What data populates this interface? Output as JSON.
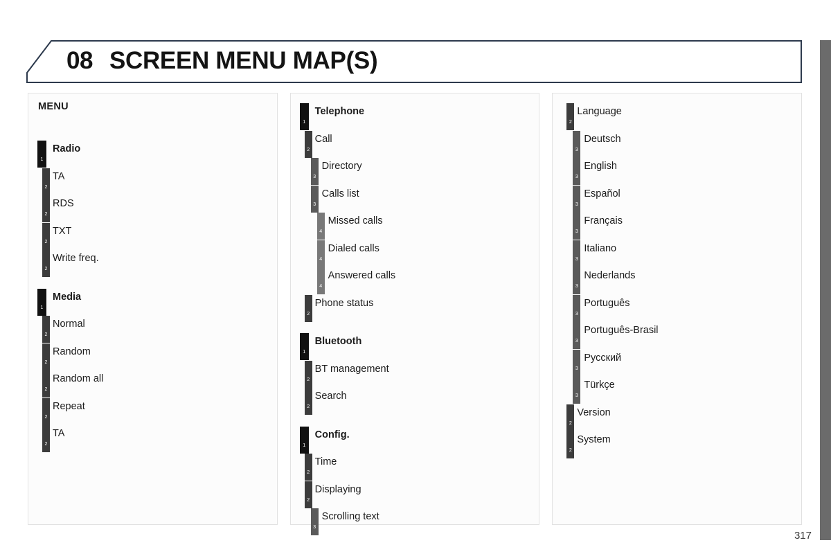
{
  "header": {
    "chapter_number": "08",
    "title": "SCREEN MENU MAP(S)",
    "border_color": "#2d3a4d"
  },
  "page_number": "317",
  "level_colors": {
    "level1": "#111111",
    "level2": "#3c3c3c",
    "level3": "#5a5a5a",
    "level4": "#787878"
  },
  "panels": [
    {
      "title": "MENU",
      "items": [
        {
          "level": 1,
          "label": "Radio",
          "gap_before": true
        },
        {
          "level": 2,
          "label": "TA",
          "gap_before": false
        },
        {
          "level": 2,
          "label": "RDS",
          "gap_before": false
        },
        {
          "level": 2,
          "label": "TXT",
          "gap_before": false
        },
        {
          "level": 2,
          "label": "Write freq.",
          "gap_before": false
        },
        {
          "level": 1,
          "label": "Media",
          "gap_before": true
        },
        {
          "level": 2,
          "label": "Normal",
          "gap_before": false
        },
        {
          "level": 2,
          "label": "Random",
          "gap_before": false
        },
        {
          "level": 2,
          "label": "Random all",
          "gap_before": false
        },
        {
          "level": 2,
          "label": "Repeat",
          "gap_before": false
        },
        {
          "level": 2,
          "label": "TA",
          "gap_before": false
        }
      ]
    },
    {
      "title": "",
      "items": [
        {
          "level": 1,
          "label": "Telephone",
          "gap_before": false
        },
        {
          "level": 2,
          "label": "Call",
          "gap_before": false
        },
        {
          "level": 3,
          "label": "Directory",
          "gap_before": false
        },
        {
          "level": 3,
          "label": "Calls list",
          "gap_before": false
        },
        {
          "level": 4,
          "label": "Missed calls",
          "gap_before": false
        },
        {
          "level": 4,
          "label": "Dialed calls",
          "gap_before": false
        },
        {
          "level": 4,
          "label": "Answered calls",
          "gap_before": false
        },
        {
          "level": 2,
          "label": "Phone status",
          "gap_before": false
        },
        {
          "level": 1,
          "label": "Bluetooth",
          "gap_before": true
        },
        {
          "level": 2,
          "label": "BT management",
          "gap_before": false
        },
        {
          "level": 2,
          "label": "Search",
          "gap_before": false
        },
        {
          "level": 1,
          "label": "Config.",
          "gap_before": true
        },
        {
          "level": 2,
          "label": "Time",
          "gap_before": false
        },
        {
          "level": 2,
          "label": "Displaying",
          "gap_before": false
        },
        {
          "level": 3,
          "label": "Scrolling text",
          "gap_before": false
        }
      ]
    },
    {
      "title": "",
      "items": [
        {
          "level": 2,
          "label": "Language",
          "gap_before": false
        },
        {
          "level": 3,
          "label": "Deutsch",
          "gap_before": false
        },
        {
          "level": 3,
          "label": "English",
          "gap_before": false
        },
        {
          "level": 3,
          "label": "Español",
          "gap_before": false
        },
        {
          "level": 3,
          "label": "Français",
          "gap_before": false
        },
        {
          "level": 3,
          "label": "Italiano",
          "gap_before": false
        },
        {
          "level": 3,
          "label": "Nederlands",
          "gap_before": false
        },
        {
          "level": 3,
          "label": "Português",
          "gap_before": false
        },
        {
          "level": 3,
          "label": "Português-Brasil",
          "gap_before": false
        },
        {
          "level": 3,
          "label": "Русский",
          "gap_before": false
        },
        {
          "level": 3,
          "label": "Türkçe",
          "gap_before": false
        },
        {
          "level": 2,
          "label": "Version",
          "gap_before": false
        },
        {
          "level": 2,
          "label": "System",
          "gap_before": false
        }
      ]
    }
  ]
}
